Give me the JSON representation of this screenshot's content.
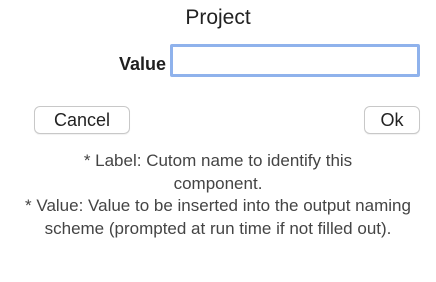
{
  "dialog": {
    "title": "Project",
    "value_label": "Value",
    "value_input": {
      "value": "",
      "placeholder": ""
    },
    "cancel_label": "Cancel",
    "ok_label": "Ok",
    "help": {
      "label_line": "* Label: Cutom name to identify this component.",
      "value_line": "* Value: Value to be inserted into the output naming scheme (prompted at run time if not filled out)."
    }
  }
}
